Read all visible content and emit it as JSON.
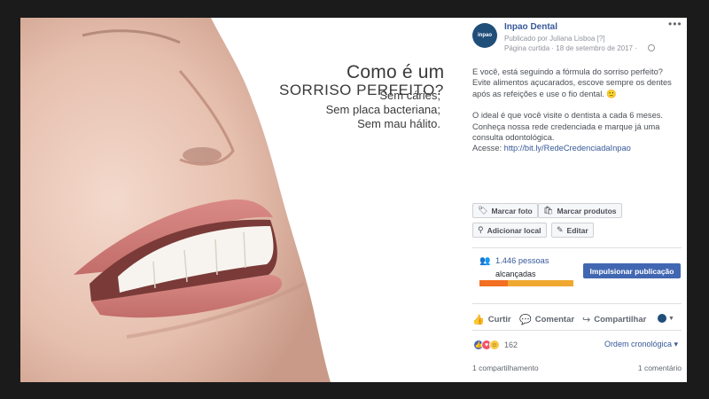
{
  "ad": {
    "title_line1": "Como é um",
    "title_line2": "SORRISO PERFEITO?",
    "lines": [
      "Sem cáries;",
      "Sem placa bacteriana;",
      "Sem mau hálito."
    ]
  },
  "post": {
    "page_name": "Inpao Dental",
    "posted_by": "Publicado por Juliana Lisboa [?]",
    "date": "Página curtida · 18 de setembro de 2017 ·",
    "avatar_text": "inpao",
    "paragraph1": "E você, está seguindo a fórmula do sorriso perfeito? Evite alimentos açucarados, escove sempre os dentes após as refeições e use o fio dental. 🙂",
    "paragraph2": "O ideal é que você visite o dentista a cada 6 meses. Conheça nossa rede credenciada e marque já uma consulta odontológica.",
    "link_prefix": "Acesse: ",
    "link": "http://bit.ly/RedeCredenciadaInpao"
  },
  "tools": {
    "tag_photo": "Marcar foto",
    "tag_products": "Marcar produtos",
    "add_location": "Adicionar local",
    "edit": "Editar"
  },
  "reach": {
    "count": "1.446 pessoas",
    "label": "alcançadas",
    "organic_fraction": 0.3,
    "boost": "Impulsionar publicação"
  },
  "actions": {
    "like": "Curtir",
    "comment": "Comentar",
    "share": "Compartilhar"
  },
  "stats": {
    "reactions_count": "162",
    "order": "Ordem cronológica ▾",
    "shares": "1 compartilhamento",
    "comments": "1 comentário"
  },
  "colors": {
    "link": "#365899",
    "boost": "#4267b2",
    "reach_organic": "#f36f21",
    "reach_paid": "#f0a830"
  }
}
